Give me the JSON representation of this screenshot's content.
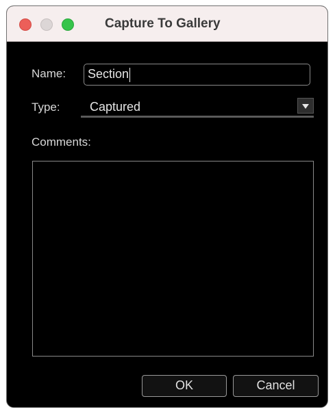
{
  "window": {
    "title": "Capture To Gallery",
    "traffic_lights": [
      "close",
      "minimize",
      "zoom"
    ]
  },
  "form": {
    "name_label": "Name:",
    "name_value": "Section",
    "type_label": "Type:",
    "type_value": "Captured",
    "comments_label": "Comments:",
    "comments_value": ""
  },
  "buttons": {
    "ok": "OK",
    "cancel": "Cancel"
  },
  "colors": {
    "window_background": "#000000",
    "titlebar_background": "#f6eeee",
    "close": "#ec5f59",
    "minimize": "#dcd6d6",
    "zoom": "#36c44b"
  }
}
